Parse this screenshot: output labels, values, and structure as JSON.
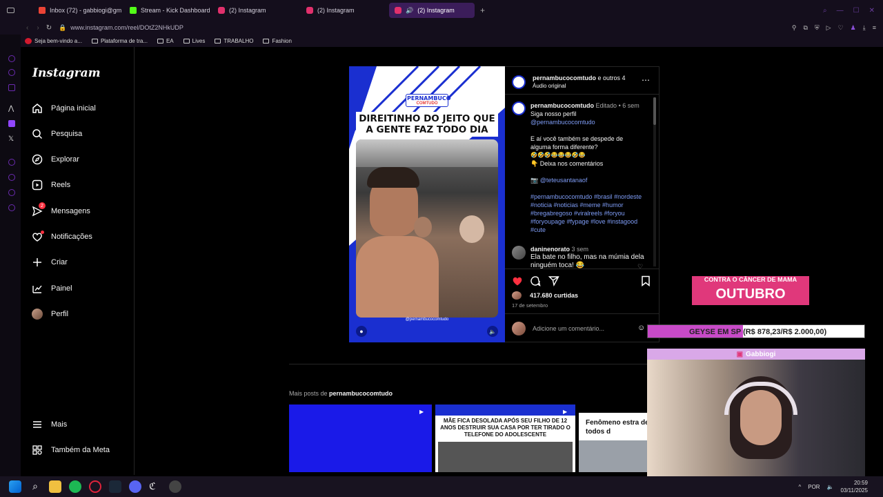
{
  "browser": {
    "tabs": [
      {
        "label": "Inbox (72) - gabbiogi@gm",
        "icon": "gmail-icon",
        "color": "#ea4335"
      },
      {
        "label": "Stream - Kick Dashboard",
        "icon": "kick-icon",
        "color": "#53fc18"
      },
      {
        "label": "(2) Instagram",
        "icon": "instagram-icon",
        "color": "#e1306c"
      },
      {
        "label": "(2) Instagram",
        "icon": "instagram-icon",
        "color": "#e1306c"
      },
      {
        "label": "(2) Instagram",
        "icon": "instagram-icon",
        "color": "#e1306c"
      }
    ],
    "url": "www.instagram.com/reel/DOtZ2NHkUDP",
    "bookmarks": [
      "Seja bem-vindo a...",
      "Plataforma de tra...",
      "EA",
      "Lives",
      "TRABALHO",
      "Fashion"
    ]
  },
  "instagram": {
    "logo": "Instagram",
    "nav": [
      {
        "label": "Página inicial",
        "icon": "home-icon"
      },
      {
        "label": "Pesquisa",
        "icon": "search-icon"
      },
      {
        "label": "Explorar",
        "icon": "compass-icon"
      },
      {
        "label": "Reels",
        "icon": "reels-icon"
      },
      {
        "label": "Mensagens",
        "icon": "messenger-icon",
        "badge": "2"
      },
      {
        "label": "Notificações",
        "icon": "heart-icon"
      },
      {
        "label": "Criar",
        "icon": "plus-icon"
      },
      {
        "label": "Painel",
        "icon": "dashboard-icon"
      },
      {
        "label": "Perfil",
        "icon": "avatar"
      }
    ],
    "bottom_nav": [
      {
        "label": "Mais",
        "icon": "menu-icon"
      },
      {
        "label": "Também da Meta",
        "icon": "meta-icon"
      }
    ],
    "video": {
      "brand": "PERNAMBUCO",
      "brand_sub": "COMTUDO",
      "headline": "DIREITINHO DO JEITO QUE A GENTE FAZ TODO DIA",
      "handle": "@pernambucocomtudo"
    },
    "post": {
      "author": "pernambucocomtudo",
      "and_others": "e outros 4",
      "audio": "Áudio original",
      "caption_user": "pernambucocomtudo",
      "edited": "Editado",
      "time": "6 sem",
      "caption_lines": [
        "Siga nosso perfil"
      ],
      "mention": "@pernambucocomtudo",
      "caption_q1": "E aí você também se despede de",
      "caption_q2": "alguma forma diferente?",
      "emojis": "🤣🤣🤣😂😂😂🤣😂",
      "comment_prompt": "👇 Deixa nos comentários",
      "credit": "@teteusantanaof",
      "hashtags": "#pernambucocomtudo #brasil #nordeste #noticia #noticias #meme #humor #bregabregoso #viralreels #foryou #foryoupage #fypage #love #instagood #cute",
      "comment_user": "daninenorato",
      "comment_time": "3 sem",
      "comment_text": "Ela bate no filho, mas na múmia dela ninguém toca! 😂",
      "likes": "417.680 curtidas",
      "date": "17 de setembro",
      "add_comment_placeholder": "Adicione um comentário..."
    },
    "more_posts": {
      "label": "Mais posts de",
      "user": "pernambucocomtudo",
      "thumbs": [
        {
          "text": ""
        },
        {
          "text": "MÃE FICA DESOLADA APÓS SEU FILHO DE 12 ANOS DESTRUIR SUA CASA POR TER TIRADO O TELEFONE DO ADOLESCENTE"
        },
        {
          "text": "Fenômeno estra deixa todos d"
        }
      ]
    }
  },
  "overlay": {
    "banner": "CONTRA O CÂNCER DE MAMA",
    "banner_big": "OUTUBRO",
    "goal_label": "GEYSE EM SP",
    "goal_value": "(R$ 878,23/R$ 2.000,00)",
    "goal_progress": 0.44,
    "cam_title": "Gabbiogi"
  },
  "taskbar": {
    "lang": "POR",
    "time": "20:59",
    "date": "03/11/2025"
  }
}
